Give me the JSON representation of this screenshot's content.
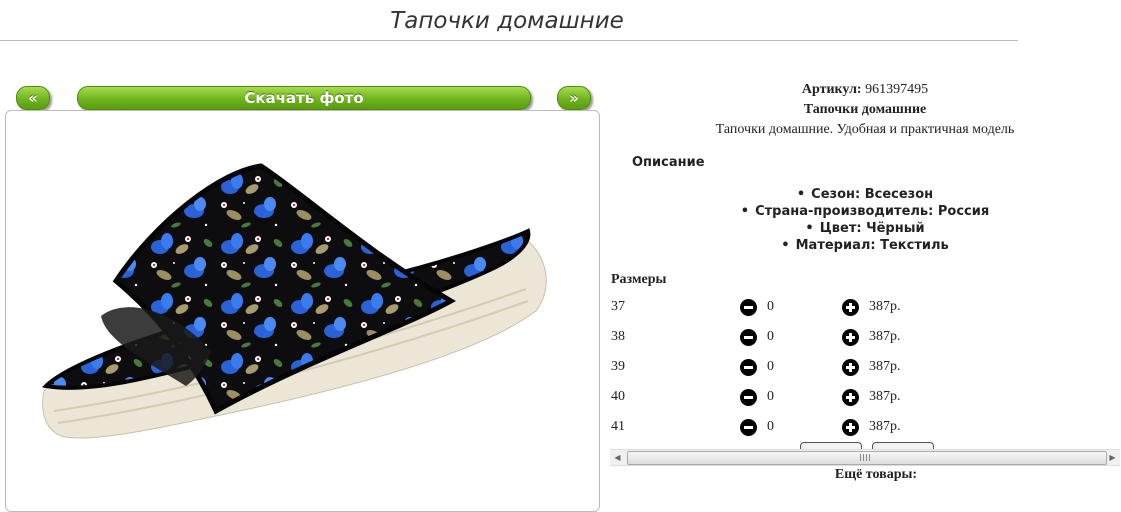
{
  "page_title": "Тапочки домашние",
  "gallery": {
    "prev_label": "«",
    "download_label": "Скачать фото",
    "next_label": "»"
  },
  "product": {
    "sku_label": "Артикул:",
    "sku_value": "961397495",
    "name": "Тапочки домашние",
    "description": "Тапочки домашние. Удобная и практичная модель",
    "description_heading": "Описание",
    "specs": [
      "Сезон: Всесезон",
      "Страна-производитель: Россия",
      "Цвет: Чёрный",
      "Материал: Текстиль"
    ]
  },
  "sizes": {
    "heading": "Размеры",
    "rows": [
      {
        "size": "37",
        "qty": "0",
        "price": "387р."
      },
      {
        "size": "38",
        "qty": "0",
        "price": "387р."
      },
      {
        "size": "39",
        "qty": "0",
        "price": "387р."
      },
      {
        "size": "40",
        "qty": "0",
        "price": "387р."
      },
      {
        "size": "41",
        "qty": "0",
        "price": "387р."
      }
    ]
  },
  "scrollbar": {
    "left_icon": "scroll-left-arrow",
    "right_icon": "scroll-right-arrow"
  },
  "more_products": "Ещё товары:",
  "colors": {
    "accent_green": "#6fb41e",
    "slipper_fabric": "#111111",
    "flower_blue": "#2a62d8",
    "sole": "#ece6d6"
  }
}
